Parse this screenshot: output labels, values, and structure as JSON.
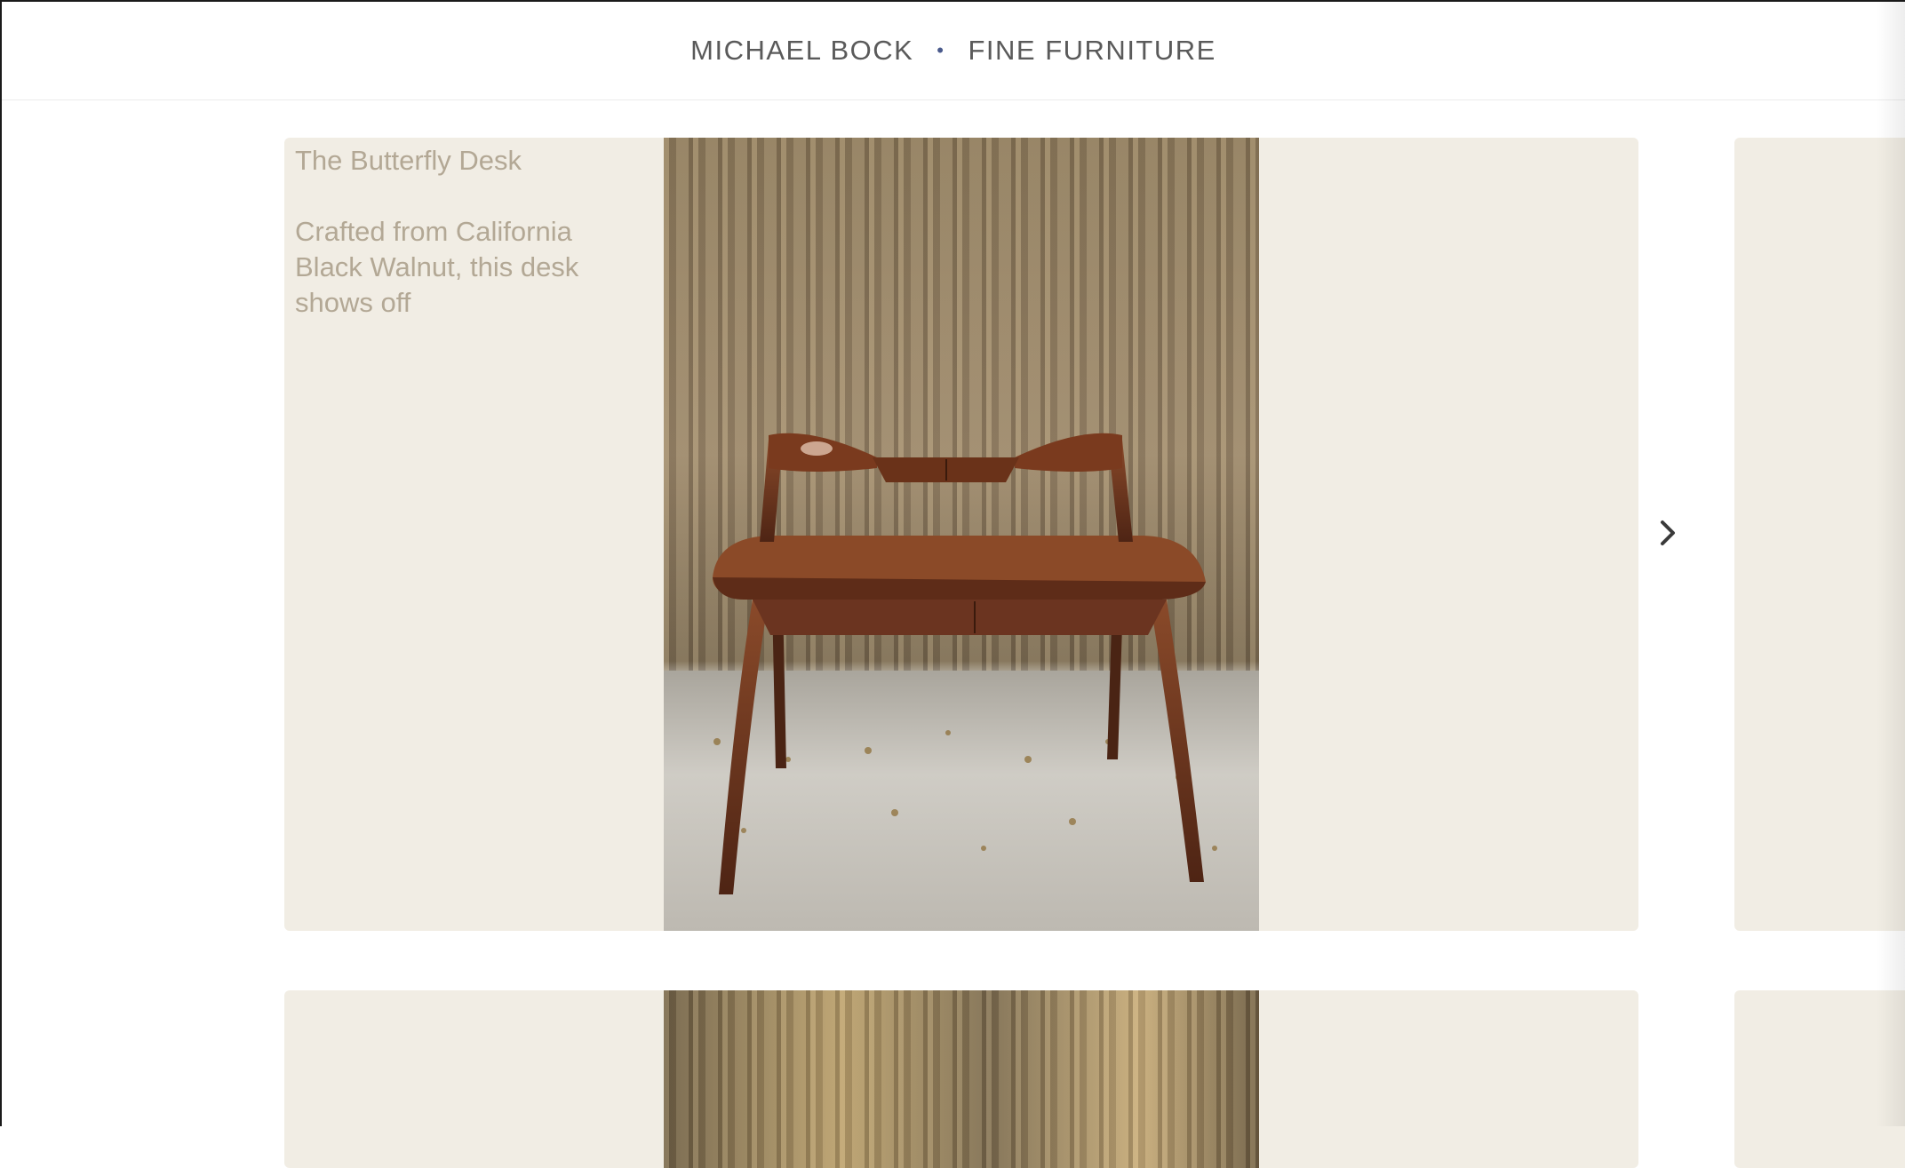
{
  "header": {
    "brand_name": "MICHAEL BOCK",
    "separator": "•",
    "tagline": "FINE FURNITURE"
  },
  "gallery": {
    "items": [
      {
        "title": "The Butterfly Desk",
        "description": "Crafted from California Black Walnut, this desk shows off"
      }
    ],
    "next_icon": "chevron-right-icon"
  },
  "colors": {
    "card_background": "#f1ede4",
    "text_muted": "#b3a895",
    "header_text": "#5a5a5a",
    "separator_dot": "#4a5a8c"
  }
}
